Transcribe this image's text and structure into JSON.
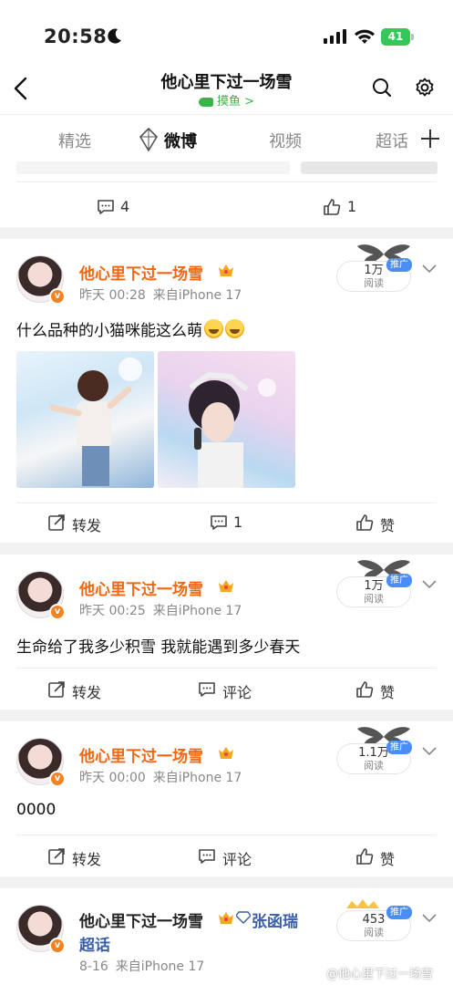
{
  "status_bar": {
    "time": "20:58",
    "battery": "41"
  },
  "nav": {
    "title": "他心里下过一场雪",
    "subtitle": "摸鱼 >"
  },
  "tabs": [
    "精选",
    "微博",
    "视频",
    "超话"
  ],
  "prev_post": {
    "comments": "4",
    "likes": "1"
  },
  "posts": [
    {
      "name": "他心里下过一场雪",
      "time": "昨天 00:28",
      "source": "来自iPhone 17",
      "reads": "1万",
      "reads_label": "阅读",
      "badge": "推广",
      "text": "什么品种的小猫咪能这么萌",
      "repost": "转发",
      "comments": "1",
      "like": "赞"
    },
    {
      "name": "他心里下过一场雪",
      "time": "昨天 00:25",
      "source": "来自iPhone 17",
      "reads": "1万",
      "reads_label": "阅读",
      "badge": "推广",
      "text": "生命给了我多少积雪 我就能遇到多少春天",
      "repost": "转发",
      "comment": "评论",
      "like": "赞"
    },
    {
      "name": "他心里下过一场雪",
      "time": "昨天 00:00",
      "source": "来自iPhone 17",
      "reads": "1.1万",
      "reads_label": "阅读",
      "badge": "推广",
      "text": "0000",
      "repost": "转发",
      "comment": "评论",
      "like": "赞"
    },
    {
      "name": "他心里下过一场雪",
      "topic": "张函瑞",
      "topic_suffix": "超话",
      "time": "8-16",
      "source": "来自iPhone 17",
      "reads": "453",
      "reads_label": "阅读",
      "badge": "推广"
    }
  ],
  "watermark": "@他心里下过一场雪",
  "colors": {
    "accent": "#f2660f",
    "green": "#3bb34a",
    "blue": "#4a8ef5",
    "link": "#3a5fa8"
  }
}
